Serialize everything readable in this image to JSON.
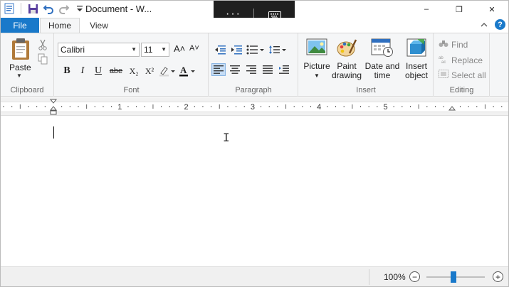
{
  "title_bar": {
    "document_title": "Document - W...",
    "qat_icons": [
      "wordpad-app-icon",
      "save-icon",
      "undo-icon",
      "redo-icon",
      "customize-qat-icon"
    ],
    "overlay": {
      "more": "···",
      "keyboard_icon": "keyboard-icon"
    },
    "window_controls": {
      "minimize": "–",
      "maximize": "❐",
      "close": "✕"
    }
  },
  "tabs": {
    "file": "File",
    "home": "Home",
    "view": "View",
    "collapse": "^",
    "help": "?"
  },
  "clipboard": {
    "paste": "Paste",
    "group": "Clipboard"
  },
  "font": {
    "name": "Calibri",
    "size": "11",
    "group": "Font",
    "grow": "A˄",
    "shrink": "A˅",
    "bold": "B",
    "italic": "I",
    "underline": "U",
    "strike": "abe",
    "subscript": "X₂",
    "superscript": "X²"
  },
  "paragraph": {
    "group": "Paragraph"
  },
  "insert": {
    "group": "Insert",
    "picture": "Picture",
    "paint_line1": "Paint",
    "paint_line2": "drawing",
    "date_line1": "Date and",
    "date_line2": "time",
    "object_line1": "Insert",
    "object_line2": "object"
  },
  "editing": {
    "group": "Editing",
    "find": "Find",
    "replace": "Replace",
    "select_all": "Select all"
  },
  "ruler": {
    "labels": [
      "1",
      "2",
      "3",
      "4",
      "5"
    ]
  },
  "status": {
    "zoom": "100%",
    "zoom_out": "−",
    "zoom_in": "+",
    "zoom_level": 0.46
  },
  "colors": {
    "accent": "#1979ca",
    "ribbon_bg": "#f5f6f7",
    "highlight": "#c5dcf5"
  }
}
